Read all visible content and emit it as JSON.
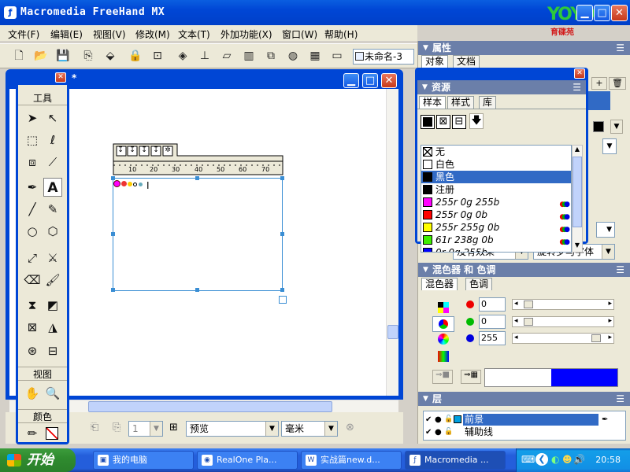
{
  "window": {
    "title": "Macromedia FreeHand MX",
    "logo_text": "YOYO",
    "logo_subtitle": "育碟苑"
  },
  "menu": [
    "文件(F)",
    "编辑(E)",
    "视图(V)",
    "修改(M)",
    "文本(T)",
    "外加功能(X)",
    "窗口(W)",
    "帮助(H)"
  ],
  "toolbar": {
    "doc_name": "未命名-3"
  },
  "document": {
    "title_suffix": "*"
  },
  "text_ruler": {
    "ticks": [
      "10",
      "20",
      "30",
      "40",
      "50",
      "60",
      "70"
    ]
  },
  "tools": {
    "title": "工具",
    "view_title": "视图",
    "color_title": "颜色",
    "text_tool_glyph": "A"
  },
  "status": {
    "page_value": "1",
    "view_mode": "预览",
    "units": "毫米"
  },
  "properties_panel": {
    "title": "属性",
    "tabs": [
      "对象",
      "文档"
    ],
    "effect_select": "没有效果",
    "rotate_select": "旋转罗马字体"
  },
  "resources_panel": {
    "title": "资源",
    "tabs": [
      "样本",
      "样式",
      "库"
    ],
    "swatches": [
      {
        "name": "无",
        "color": "none"
      },
      {
        "name": "白色",
        "color": "#ffffff"
      },
      {
        "name": "黑色",
        "color": "#000000",
        "selected": true
      },
      {
        "name": "注册",
        "color": "#000000"
      },
      {
        "name": "255r 0g 255b",
        "color": "#ff00ff"
      },
      {
        "name": "255r 0g 0b",
        "color": "#ff0000"
      },
      {
        "name": "255r 255g 0b",
        "color": "#ffff00"
      },
      {
        "name": "61r 238g 0b",
        "color": "#3dee00"
      },
      {
        "name": "0r 0g 255b",
        "color": "#0000ff"
      }
    ]
  },
  "mixer_panel": {
    "title": "混色器 和 色调",
    "tabs": [
      "混色器",
      "色调"
    ],
    "r_value": "0",
    "g_value": "0",
    "b_value": "255",
    "preview_color": "#0000ff"
  },
  "layers_panel": {
    "title": "层",
    "layers": [
      {
        "name": "前景",
        "selected": true
      },
      {
        "name": "辅助线",
        "selected": false
      }
    ]
  },
  "taskbar": {
    "start_label": "开始",
    "tasks": [
      {
        "label": "我的电脑",
        "active": false
      },
      {
        "label": "RealOne Pla...",
        "active": false
      },
      {
        "label": "实战篇new.d...",
        "active": false
      },
      {
        "label": "Macromedia ...",
        "active": true
      }
    ],
    "clock": "20:58"
  }
}
